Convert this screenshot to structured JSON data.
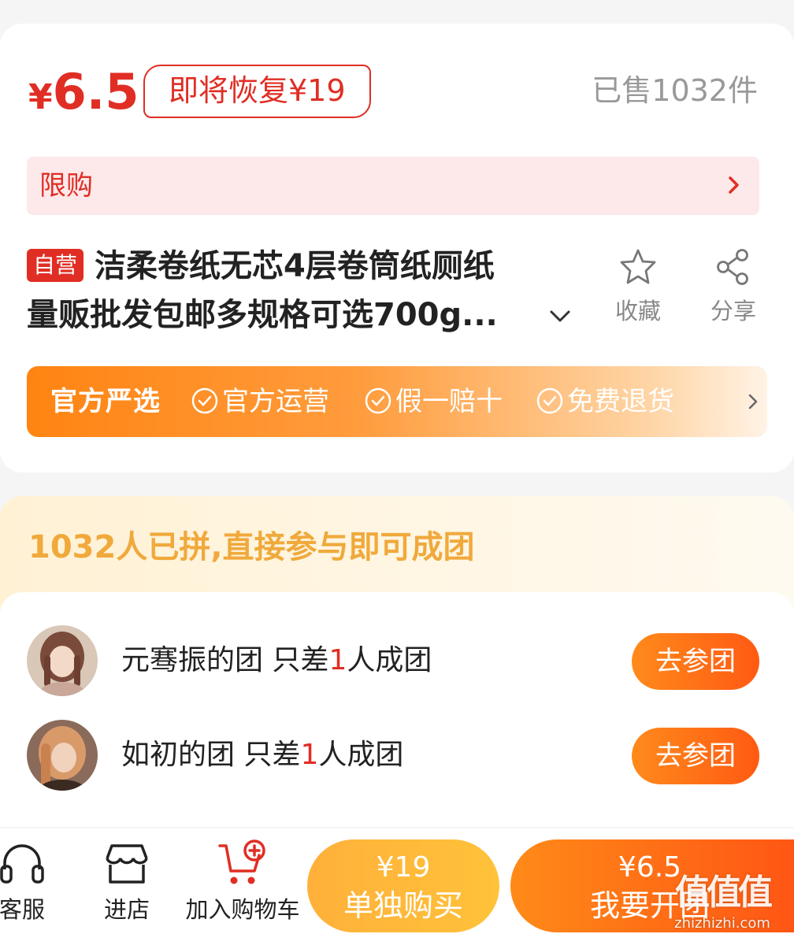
{
  "product": {
    "price_currency": "¥",
    "price_value": "6.5",
    "restore_price": "即将恢复¥19",
    "sold": "已售1032件",
    "limit_label": "限购",
    "tag": "自营",
    "title_line1": "洁柔卷纸无芯4层卷筒纸厕纸",
    "title_line2": "量贩批发包邮多规格可选700g...",
    "favorite_label": "收藏",
    "share_label": "分享",
    "official": {
      "title": "官方严选",
      "items": [
        "官方运营",
        "假一赔十",
        "免费退货"
      ]
    }
  },
  "group": {
    "heading": "1032人已拼,直接参与即可成团",
    "rows": [
      {
        "name": "元骞振的团",
        "prefix": "只差",
        "count": "1",
        "suffix": "人成团",
        "button": "去参团"
      },
      {
        "name": "如初的团",
        "prefix": "只差",
        "count": "1",
        "suffix": "人成团",
        "button": "去参团"
      }
    ]
  },
  "bottom": {
    "customer_service": "客服",
    "shop": "进店",
    "cart": "加入购物车",
    "alone_price": "¥19",
    "alone_label": "单独购买",
    "group_price": "¥6.5",
    "group_label": "我要开团"
  },
  "watermark": {
    "glyphs": "值值值",
    "url": "zhizhizhi.com"
  },
  "colors": {
    "accent_red": "#e02e24",
    "accent_orange": "#ff6a14",
    "group_heading": "#f0a93b"
  }
}
